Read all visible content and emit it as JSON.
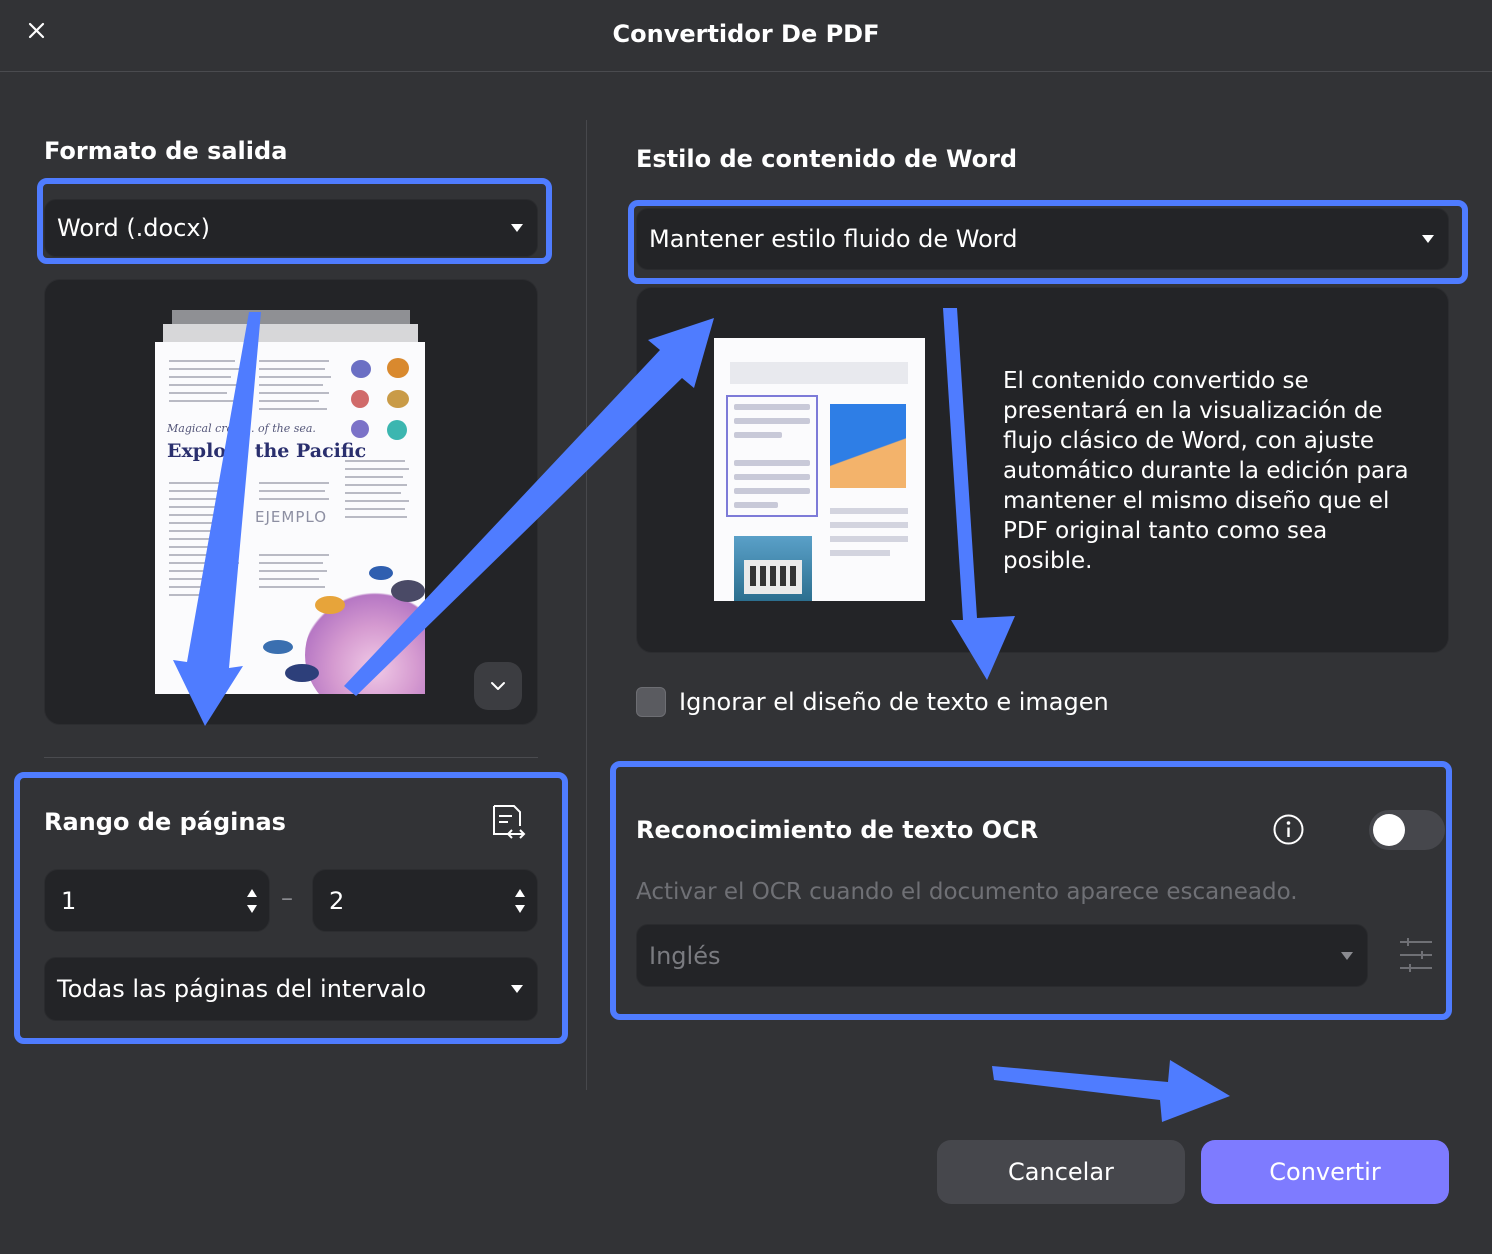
{
  "window": {
    "title": "Convertidor De PDF"
  },
  "output_format": {
    "heading": "Formato de salida",
    "selected": "Word (.docx)",
    "preview": {
      "subtitle": "Magical creat... of the sea.",
      "title": "Explore the Pacific",
      "watermark": "EJEMPLO"
    }
  },
  "page_range": {
    "heading": "Rango de páginas",
    "from": "1",
    "separator": "–",
    "to": "2",
    "mode": "Todas las páginas del intervalo"
  },
  "word_style": {
    "heading": "Estilo de contenido de Word",
    "selected": "Mantener estilo fluido de Word",
    "description": "El contenido convertido se presentará en la visualización de flujo clásico de Word, con ajuste automático durante la edición para mantener el mismo diseño que el PDF original tanto como sea posible."
  },
  "ignore_layout": {
    "label": "Ignorar el diseño de texto e imagen",
    "checked": false
  },
  "ocr": {
    "title": "Reconocimiento de texto OCR",
    "enabled": false,
    "description": "Activar el OCR cuando el documento aparece escaneado.",
    "language": "Inglés"
  },
  "footer": {
    "cancel_label": "Cancelar",
    "convert_label": "Convertir"
  },
  "colors": {
    "background": "#323336",
    "highlight": "#4f7cff",
    "primary_button": "#7e7bff"
  },
  "icons": [
    "close-icon",
    "chevron-down-icon",
    "page-range-swap-icon",
    "info-icon",
    "sliders-icon"
  ]
}
